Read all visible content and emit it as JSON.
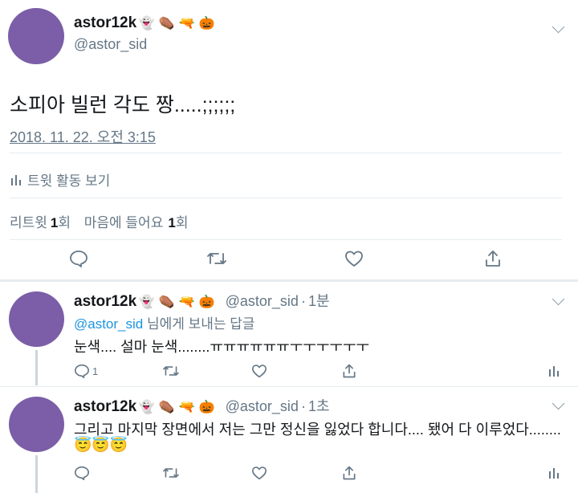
{
  "main_tweet": {
    "display_name": "astor12k",
    "name_emojis": [
      "👻",
      "⚰️",
      "🔫",
      "🎃"
    ],
    "handle": "@astor_sid",
    "text": "소피아 빌런 각도 짱.....;;;;;;",
    "timestamp": "2018. 11. 22. 오전 3:15",
    "activity_label": "트윗 활동 보기",
    "retweet_label": "리트윗",
    "retweet_count": "1",
    "retweet_unit": "회",
    "like_label": "마음에 들어요",
    "like_count": "1",
    "like_unit": "회"
  },
  "replies": [
    {
      "display_name": "astor12k",
      "name_emojis": [
        "👻",
        "⚰️",
        "🔫",
        "🎃"
      ],
      "handle": "@astor_sid",
      "sep": "·",
      "time": "1분",
      "replying_handle": "@astor_sid",
      "replying_text": "님에게 보내는 답글",
      "text": "눈색.... 설마 눈색........ㅠㅠㅠㅠㅠㅠㅜㅜㅜㅜㅜㅜ",
      "reply_count": "1"
    },
    {
      "display_name": "astor12k",
      "name_emojis": [
        "👻",
        "⚰️",
        "🔫",
        "🎃"
      ],
      "handle": "@astor_sid",
      "sep": "·",
      "time": "1초",
      "text": "그리고 마지막 장면에서 저는 그만 정신을 잃었다 합니다.... 됐어 다 이루었다........",
      "text_emojis": [
        "😇",
        "😇",
        "😇"
      ]
    }
  ]
}
